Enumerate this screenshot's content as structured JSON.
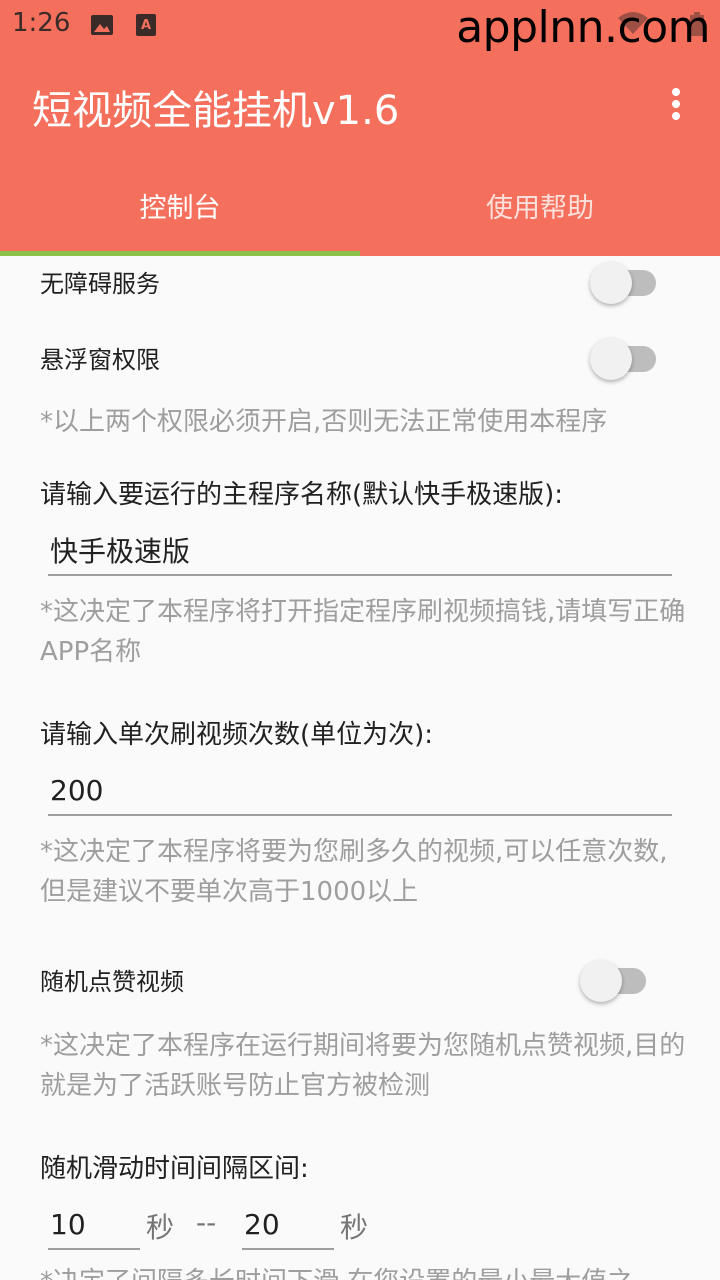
{
  "status_bar": {
    "time": "1:26",
    "watermark": "applnn.com",
    "icons": [
      "gallery-icon",
      "a-store-icon",
      "wifi-icon",
      "battery-icon"
    ]
  },
  "app": {
    "title": "短视频全能挂机v1.6",
    "menu_icon": "more-vert-icon",
    "colors": {
      "primary": "#f4705c",
      "indicator": "#8bc34a",
      "hint": "#9e9e9e"
    }
  },
  "tabs": [
    {
      "label": "控制台",
      "selected": true
    },
    {
      "label": "使用帮助",
      "selected": false
    }
  ],
  "permissions": {
    "accessibility_label": "无障碍服务",
    "accessibility_on": false,
    "overlay_label": "悬浮窗权限",
    "overlay_on": false,
    "hint": "*以上两个权限必须开启,否则无法正常使用本程序"
  },
  "app_name": {
    "prompt": "请输入要运行的主程序名称(默认快手极速版):",
    "value": "快手极速版",
    "hint": "*这决定了本程序将打开指定程序刷视频搞钱,请填写正确APP名称"
  },
  "video_count": {
    "prompt": "请输入单次刷视频次数(单位为次):",
    "value": "200",
    "hint": "*这决定了本程序将要为您刷多久的视频,可以任意次数,但是建议不要单次高于1000以上"
  },
  "random_like": {
    "label": "随机点赞视频",
    "on": false,
    "hint": "*这决定了本程序在运行期间将要为您随机点赞视频,目的就是为了活跃账号防止官方被检测"
  },
  "interval": {
    "prompt": "随机滑动时间间隔区间:",
    "min": "10",
    "max": "20",
    "unit": "秒",
    "separator": "--",
    "hint": "*决定了间隔多长时间下滑,在您设置的最小最大值之"
  }
}
